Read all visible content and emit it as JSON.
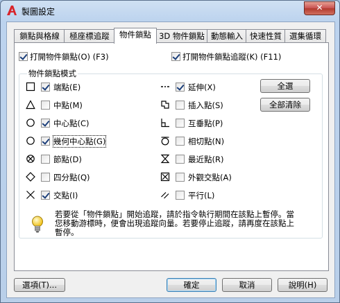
{
  "window": {
    "title": "製圖設定",
    "close_glyph": "✕"
  },
  "tabs": [
    "鎖點與格線",
    "極座標追蹤",
    "物件鎖點",
    "3D 物件鎖點",
    "動態輸入",
    "快速性質",
    "選集循環"
  ],
  "active_tab": 2,
  "top_options": {
    "snap_on": {
      "label": "打開物件鎖點(O) (F3)",
      "checked": true
    },
    "tracking_on": {
      "label": "打開物件鎖點追蹤(K) (F11)",
      "checked": true
    }
  },
  "group": {
    "title": "物件鎖點模式"
  },
  "modes_left": [
    {
      "label": "端點(E)",
      "checked": true,
      "icon": "endpoint-square-icon"
    },
    {
      "label": "中點(M)",
      "checked": false,
      "icon": "midpoint-triangle-icon"
    },
    {
      "label": "中心點(C)",
      "checked": true,
      "icon": "center-circle-icon"
    },
    {
      "label": "幾何中心點(G)",
      "checked": true,
      "icon": "geometric-center-icon"
    },
    {
      "label": "節點(D)",
      "checked": false,
      "icon": "node-icon"
    },
    {
      "label": "四分點(Q)",
      "checked": false,
      "icon": "quadrant-diamond-icon"
    },
    {
      "label": "交點(I)",
      "checked": true,
      "icon": "intersection-x-icon"
    }
  ],
  "modes_right": [
    {
      "label": "延伸(X)",
      "checked": true,
      "icon": "extension-icon"
    },
    {
      "label": "插入點(S)",
      "checked": false,
      "icon": "insertion-icon"
    },
    {
      "label": "互垂點(P)",
      "checked": false,
      "icon": "perpendicular-icon"
    },
    {
      "label": "相切點(N)",
      "checked": false,
      "icon": "tangent-icon"
    },
    {
      "label": "最近點(R)",
      "checked": false,
      "icon": "nearest-hourglass-icon"
    },
    {
      "label": "外觀交點(A)",
      "checked": false,
      "icon": "apparent-intersection-icon"
    },
    {
      "label": "平行(L)",
      "checked": false,
      "icon": "parallel-icon"
    }
  ],
  "side_buttons": {
    "select_all": "全選",
    "clear_all": "全部清除"
  },
  "hint": {
    "icon": "lightbulb-icon",
    "text": "若要從「物件鎖點」開始追蹤，請於指令執行期間在該點上暫停。當您移動游標時，便會出現追蹤向量。若要停止追蹤，請再度在該點上暫停。"
  },
  "footer": {
    "options": "選項(T)...",
    "ok": "確定",
    "cancel": "取消",
    "help": "說明(H)"
  }
}
